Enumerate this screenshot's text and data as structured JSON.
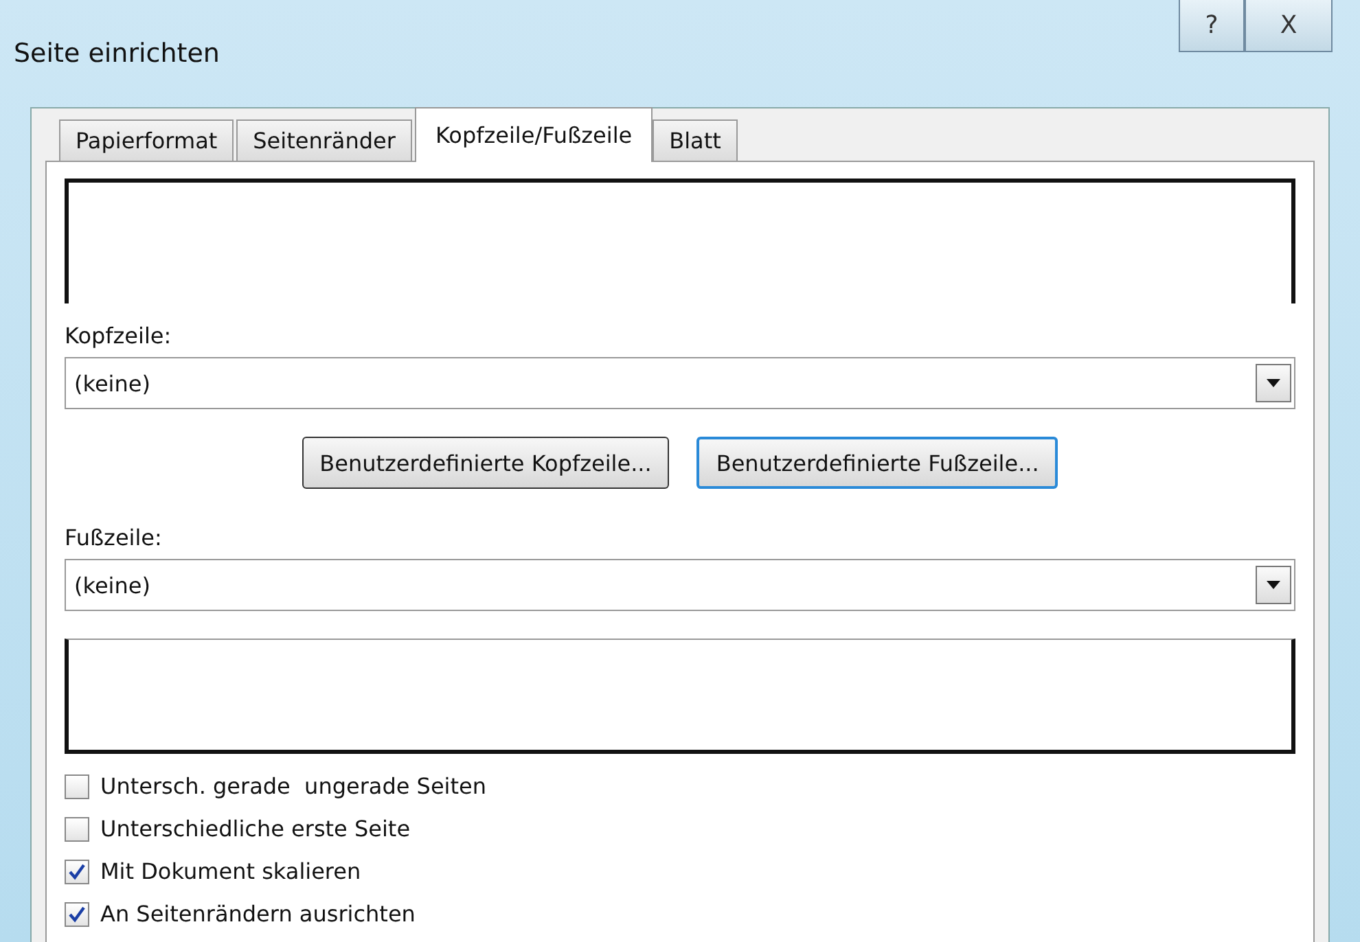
{
  "window": {
    "title": "Seite einrichten"
  },
  "title_buttons": [
    {
      "kind": "help",
      "label": "?"
    },
    {
      "kind": "close",
      "label": "X"
    }
  ],
  "tabs": [
    {
      "label": "Papierformat",
      "selected": false
    },
    {
      "label": "Seitenränder",
      "selected": false
    },
    {
      "label": "Kopfzeile/Fußzeile",
      "selected": true
    },
    {
      "label": "Blatt",
      "selected": false
    }
  ],
  "header": {
    "label": "Kopfzeile:",
    "value": "(keine)"
  },
  "buttons": [
    {
      "label": "Benutzerdefinierte Kopfzeile...",
      "focused": false
    },
    {
      "label": "Benutzerdefinierte Fußzeile...",
      "focused": true
    }
  ],
  "footer": {
    "label": "Fußzeile:",
    "value": "(keine)"
  },
  "options": [
    {
      "label": "Untersch. gerade  ungerade Seiten",
      "checked": false
    },
    {
      "label": "Unterschiedliche erste Seite",
      "checked": false
    },
    {
      "label": "Mit Dokument skalieren",
      "checked": true
    },
    {
      "label": "An Seitenrändern ausrichten",
      "checked": true
    }
  ]
}
